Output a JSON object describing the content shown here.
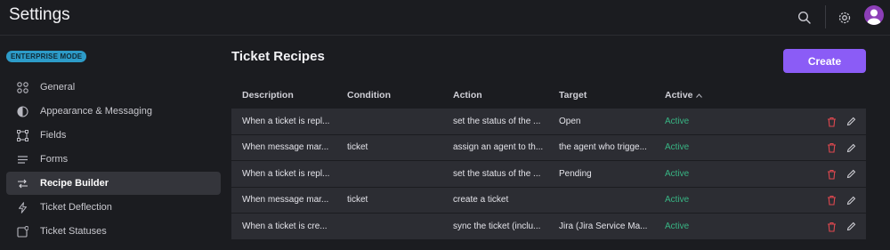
{
  "header": {
    "title": "Settings"
  },
  "sidebar": {
    "badge": "ENTERPRISE MODE",
    "items": [
      {
        "label": "General",
        "icon": "grid-icon"
      },
      {
        "label": "Appearance & Messaging",
        "icon": "contrast-icon"
      },
      {
        "label": "Fields",
        "icon": "fields-icon"
      },
      {
        "label": "Forms",
        "icon": "forms-icon"
      },
      {
        "label": "Recipe Builder",
        "icon": "recipe-icon",
        "active": true
      },
      {
        "label": "Ticket Deflection",
        "icon": "bolt-icon"
      },
      {
        "label": "Ticket Statuses",
        "icon": "status-icon"
      }
    ]
  },
  "main": {
    "title": "Ticket Recipes",
    "create_label": "Create",
    "columns": [
      "Description",
      "Condition",
      "Action",
      "Target",
      "Active"
    ],
    "rows": [
      {
        "description": "When a ticket is repl...",
        "condition": "",
        "action": "set the status of the ...",
        "target": "Open",
        "active": "Active"
      },
      {
        "description": "When message mar...",
        "condition": "ticket",
        "action": "assign an agent to th...",
        "target": "the agent who trigge...",
        "active": "Active"
      },
      {
        "description": "When a ticket is repl...",
        "condition": "",
        "action": "set the status of the ...",
        "target": "Pending",
        "active": "Active"
      },
      {
        "description": "When message mar...",
        "condition": "ticket",
        "action": "create a ticket",
        "target": "",
        "active": "Active"
      },
      {
        "description": "When a ticket is cre...",
        "condition": "",
        "action": "sync the ticket (inclu...",
        "target": "Jira (Jira Service Ma...",
        "active": "Active"
      }
    ]
  },
  "colors": {
    "accent": "#8b5cf6",
    "active_status": "#38b584",
    "badge": "#2d9bc8",
    "delete": "#e0484f"
  }
}
